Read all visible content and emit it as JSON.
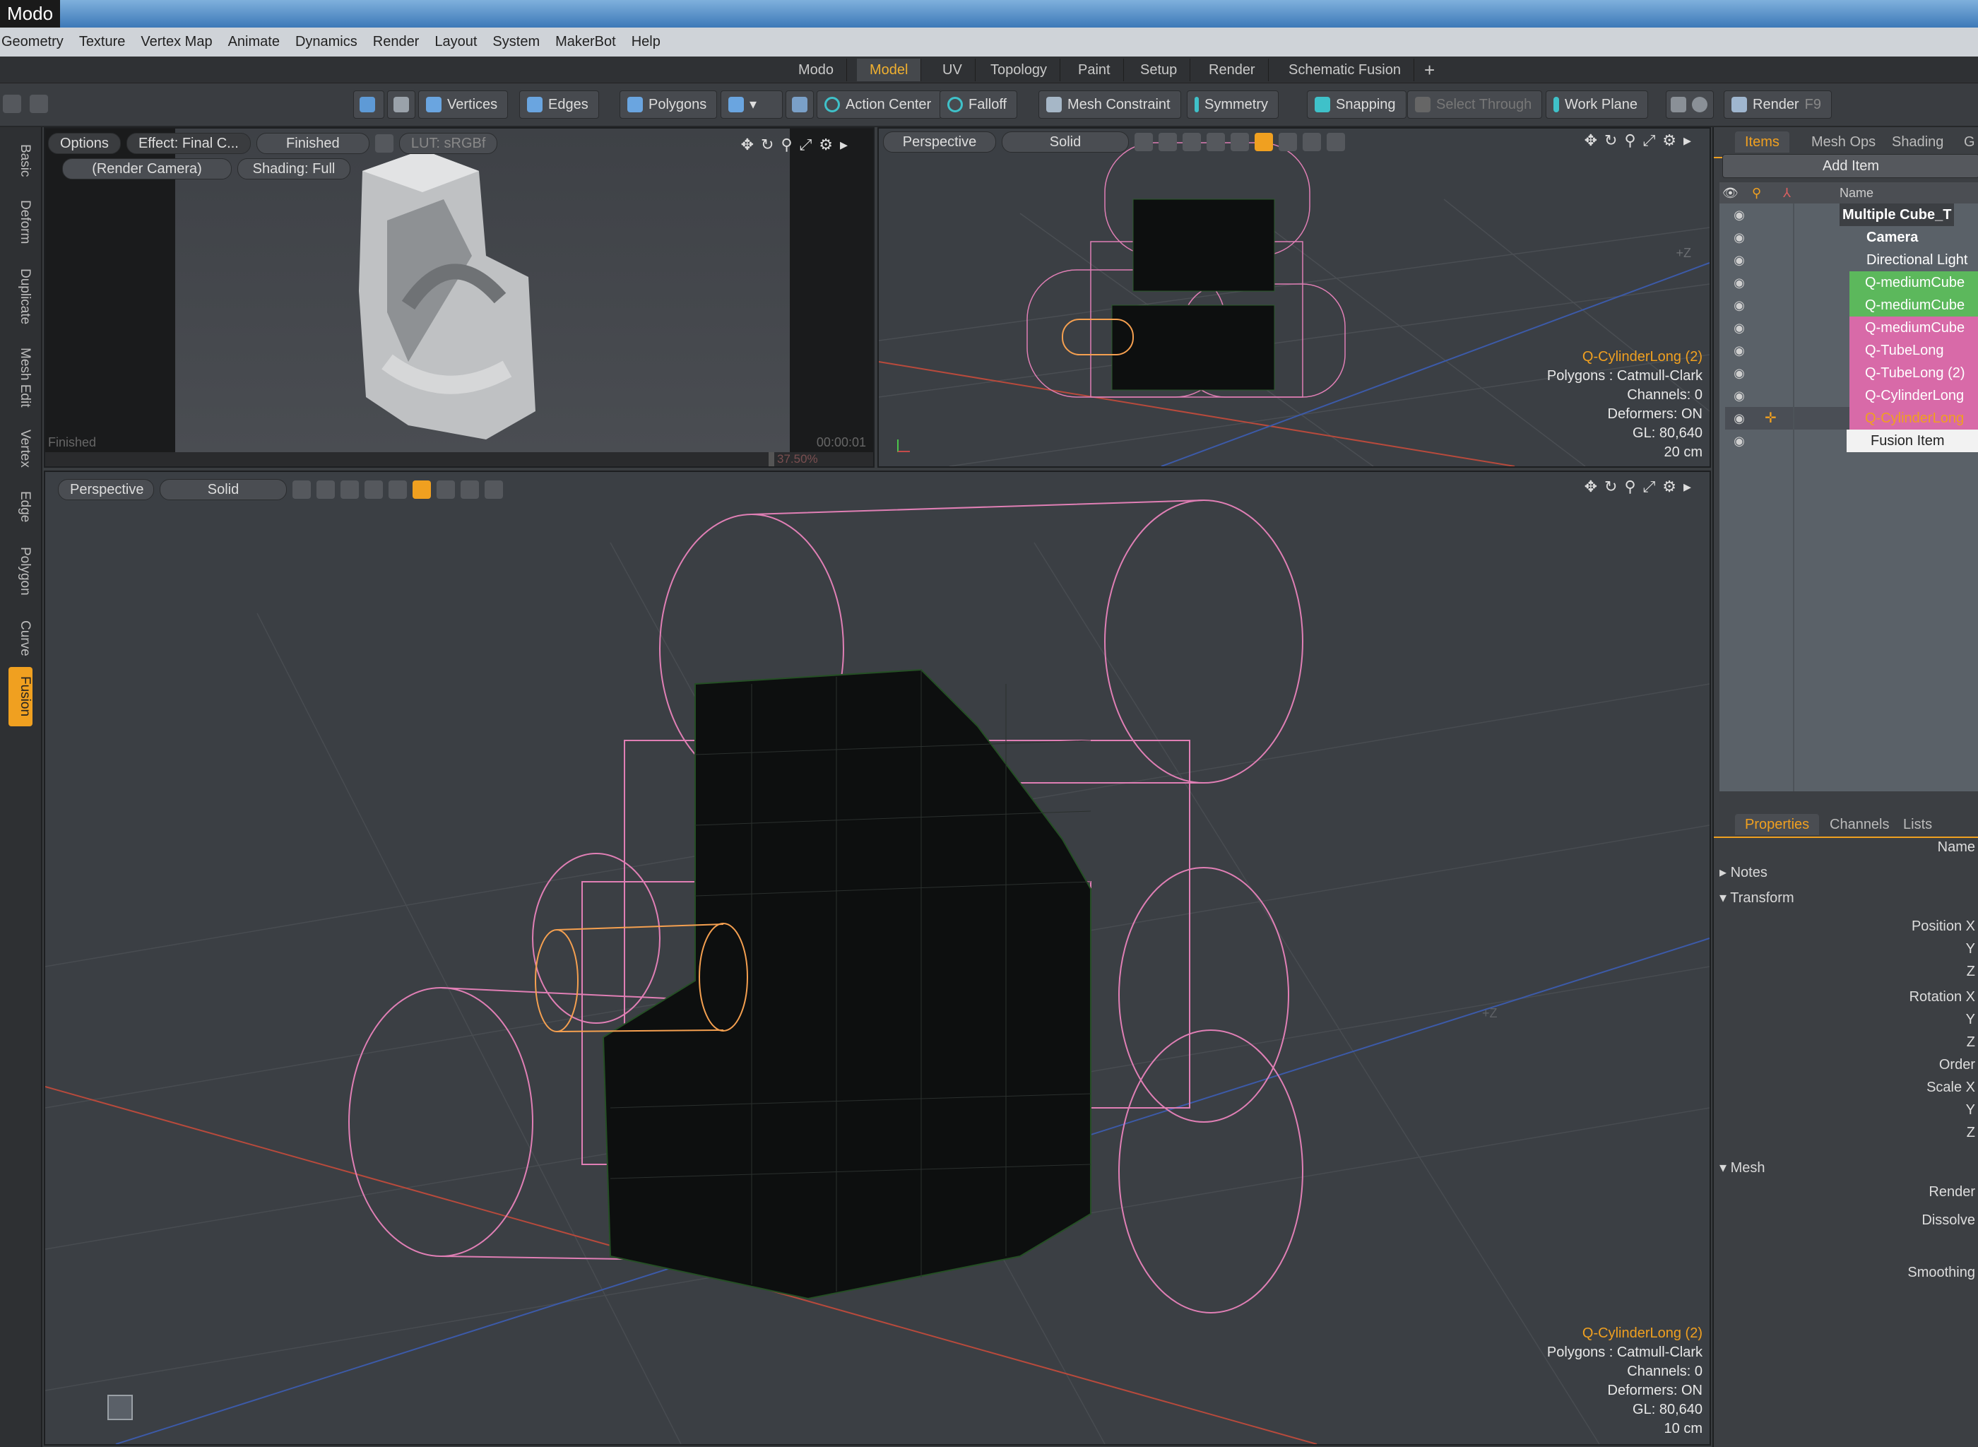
{
  "window": {
    "title": "Modo"
  },
  "menu": [
    "Geometry",
    "Texture",
    "Vertex Map",
    "Animate",
    "Dynamics",
    "Render",
    "Layout",
    "System",
    "MakerBot",
    "Help"
  ],
  "layout_tabs": [
    "Modo",
    "Model",
    "UV",
    "Topology",
    "Paint",
    "Setup",
    "Render",
    "Schematic Fusion",
    "+"
  ],
  "layout_tab_active": "Model",
  "toolbar": {
    "vertices": "Vertices",
    "edges": "Edges",
    "polygons": "Polygons",
    "action_center": "Action Center",
    "falloff": "Falloff",
    "mesh_constraint": "Mesh Constraint",
    "symmetry": "Symmetry",
    "snapping": "Snapping",
    "select_through": "Select Through",
    "work_plane": "Work Plane",
    "render": "Render",
    "render_key": "F9"
  },
  "left_tabs": [
    "Basic",
    "Deform",
    "Duplicate",
    "Mesh Edit",
    "Vertex",
    "Edge",
    "Polygon",
    "Curve",
    "Fusion"
  ],
  "left_tab_active": "Fusion",
  "render_view": {
    "options": "Options",
    "effect": "Effect: Final C...",
    "finished_btn": "Finished",
    "lut": "LUT: sRGBf",
    "camera": "(Render Camera)",
    "shading": "Shading: Full",
    "status": "Finished",
    "time": "00:00:01",
    "percent": "37.50%"
  },
  "viewport_top": {
    "mode": "Perspective",
    "shading": "Solid",
    "axis_label": "+Z",
    "info": {
      "selected": "Q-CylinderLong (2)",
      "polygons": "Polygons : Catmull-Clark",
      "channels": "Channels: 0",
      "deformers": "Deformers: ON",
      "gl": "GL: 80,640",
      "scale": "20 cm"
    }
  },
  "viewport_main": {
    "mode": "Perspective",
    "shading": "Solid",
    "axis_label": "+Z",
    "info": {
      "selected": "Q-CylinderLong (2)",
      "polygons": "Polygons : Catmull-Clark",
      "channels": "Channels: 0",
      "deformers": "Deformers: ON",
      "gl": "GL: 80,640",
      "scale": "10 cm"
    }
  },
  "items_panel": {
    "tabs": [
      "Items",
      "Mesh Ops",
      "Shading",
      "G"
    ],
    "active_tab": "Items",
    "add_item": "Add Item",
    "col_name": "Name",
    "items": [
      {
        "name": "Multiple Cube_T",
        "color": "#3c3f43"
      },
      {
        "name": "Camera",
        "color": "#3c3f43"
      },
      {
        "name": "Directional Light",
        "color": "#3c3f43"
      },
      {
        "name": "Q-mediumCube",
        "color": "#5cb85c"
      },
      {
        "name": "Q-mediumCube",
        "color": "#5cb85c"
      },
      {
        "name": "Q-mediumCube",
        "color": "#d86aa8"
      },
      {
        "name": "Q-TubeLong",
        "color": "#d86aa8"
      },
      {
        "name": "Q-TubeLong (2)",
        "color": "#d86aa8"
      },
      {
        "name": "Q-CylinderLong",
        "color": "#d86aa8"
      },
      {
        "name": "Q-CylinderLong",
        "color": "#d86aa8"
      },
      {
        "name": "Fusion Item",
        "color": "#f2f2f2"
      }
    ]
  },
  "properties_panel": {
    "tabs": [
      "Properties",
      "Channels",
      "Lists"
    ],
    "active_tab": "Properties",
    "name_label": "Name",
    "notes": "Notes",
    "transform": "Transform",
    "position_x": "Position X",
    "y": "Y",
    "z": "Z",
    "rotation_x": "Rotation X",
    "order": "Order",
    "scale_x": "Scale X",
    "mesh": "Mesh",
    "render": "Render",
    "dissolve": "Dissolve",
    "smoothing": "Smoothing"
  },
  "colors": {
    "accent": "#f0a020",
    "wire_pink": "#e07fb5",
    "wire_orange": "#f5a050",
    "mesh_dark": "#0d0f0f"
  }
}
